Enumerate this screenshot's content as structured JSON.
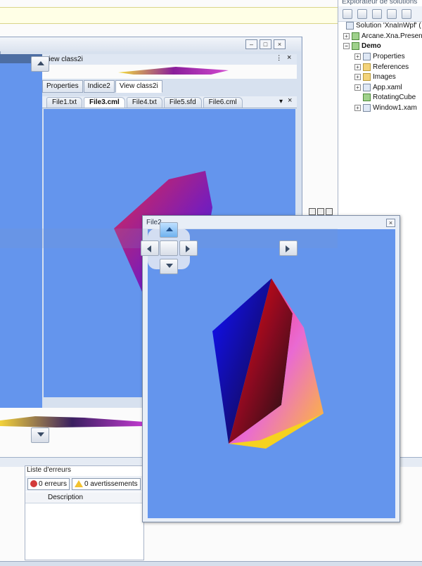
{
  "solution_explorer": {
    "title": "Explorateur de solutions",
    "items": [
      {
        "label": "Solution 'XnaInWpf' ("
      },
      {
        "label": "Arcane.Xna.Presen"
      },
      {
        "label": "Demo"
      },
      {
        "label": "Properties"
      },
      {
        "label": "References"
      },
      {
        "label": "Images"
      },
      {
        "label": "App.xaml"
      },
      {
        "label": "RotatingCube"
      },
      {
        "label": "Window1.xam"
      }
    ]
  },
  "doc_window": {
    "panel_title": "View class2i",
    "tabs": [
      {
        "label": "Properties"
      },
      {
        "label": "Indice2"
      },
      {
        "label": "View class2i"
      }
    ],
    "file_tabs": [
      {
        "label": "File1.txt"
      },
      {
        "label": "File3.cml"
      },
      {
        "label": "File4.txt"
      },
      {
        "label": "File5.sfd"
      },
      {
        "label": "File6.cml"
      }
    ],
    "buttons": {
      "minimize": "–",
      "restore": "□",
      "close": "×",
      "pin": "ⵗ",
      "dropdown": "▾"
    }
  },
  "float_window": {
    "title": "File2",
    "close": "×"
  },
  "errors_panel": {
    "title": "Liste d'erreurs",
    "errors_button": "0 erreurs",
    "warnings_button": "0 avertissements",
    "column_description": "Description"
  },
  "colors": {
    "viewport": "#6495ed",
    "accent": "#4d6ea3"
  }
}
